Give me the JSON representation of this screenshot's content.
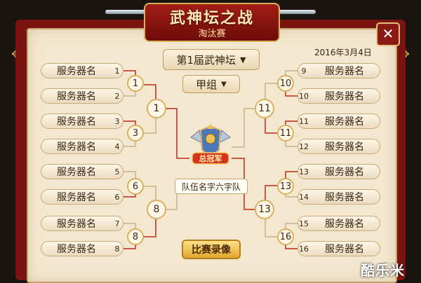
{
  "banner": {
    "title": "武神坛之战",
    "subtitle": "淘汰赛"
  },
  "close_icon": "close-icon",
  "season_dropdown": {
    "value": "第1届武神坛",
    "icon": "chevron-down-icon"
  },
  "group_dropdown": {
    "value": "甲组",
    "icon": "chevron-down-icon"
  },
  "date": "2016年3月4日",
  "left_servers": [
    {
      "name": "服务器名",
      "seed": "1"
    },
    {
      "name": "服务器名",
      "seed": "2"
    },
    {
      "name": "服务器名",
      "seed": "3"
    },
    {
      "name": "服务器名",
      "seed": "4"
    },
    {
      "name": "服务器名",
      "seed": "5"
    },
    {
      "name": "服务器名",
      "seed": "6"
    },
    {
      "name": "服务器名",
      "seed": "7"
    },
    {
      "name": "服务器名",
      "seed": "8"
    }
  ],
  "right_servers": [
    {
      "name": "服务器名",
      "seed": "9"
    },
    {
      "name": "服务器名",
      "seed": "10"
    },
    {
      "name": "服务器名",
      "seed": "11"
    },
    {
      "name": "服务器名",
      "seed": "12"
    },
    {
      "name": "服务器名",
      "seed": "13"
    },
    {
      "name": "服务器名",
      "seed": "14"
    },
    {
      "name": "服务器名",
      "seed": "15"
    },
    {
      "name": "服务器名",
      "seed": "16"
    }
  ],
  "left_round1": [
    "1",
    "3",
    "6",
    "8"
  ],
  "left_round2": [
    "1",
    "8"
  ],
  "right_round1": [
    "10",
    "11",
    "13",
    "16"
  ],
  "right_round2": [
    "11",
    "13"
  ],
  "champion": {
    "emblem_text": "总冠军",
    "team_name": "队伍名字六字队"
  },
  "record_button": "比赛录像",
  "watermark": "酷乐米",
  "colors": {
    "accent_red": "#c0281c",
    "gold": "#d7b060",
    "parchment": "#f3e7cf"
  }
}
